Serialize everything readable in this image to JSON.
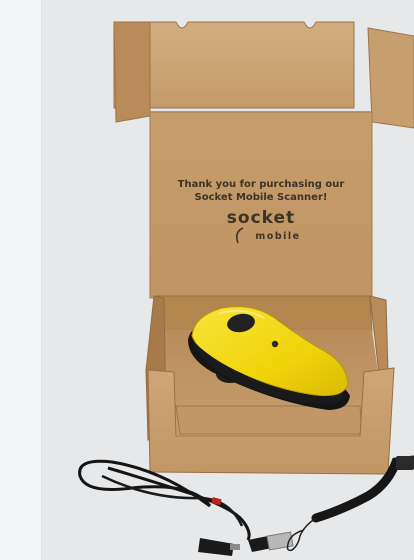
{
  "lid_message": {
    "line1": "Thank you for purchasing our",
    "line2": "Socket Mobile Scanner!"
  },
  "brand": {
    "name": "socket",
    "tagline": "mobile"
  },
  "colors": {
    "cardboard": "#c49a69",
    "cardboard_dark": "#9f7547",
    "scanner_yellow": "#f2d90a",
    "scanner_black": "#1c1c1c",
    "background": "#e6e8ea"
  },
  "objects": [
    "box-lid",
    "box-tray",
    "yellow-barcode-scanner",
    "usb-cable",
    "wrist-lanyard"
  ]
}
